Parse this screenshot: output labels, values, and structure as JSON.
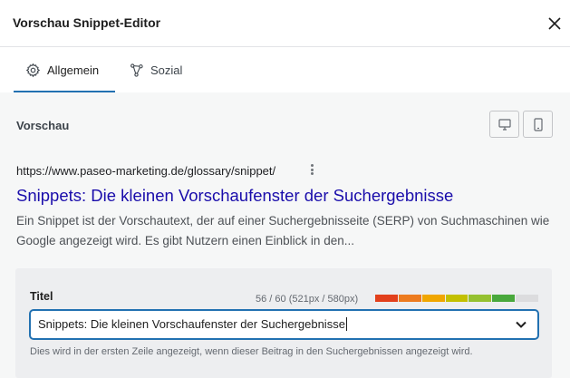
{
  "window": {
    "title": "Vorschau Snippet-Editor"
  },
  "tabs": [
    {
      "label": "Allgemein",
      "icon": "gear-icon",
      "active": true
    },
    {
      "label": "Sozial",
      "icon": "share-icon",
      "active": false
    }
  ],
  "preview": {
    "heading": "Vorschau",
    "device_buttons": [
      {
        "icon": "desktop-icon"
      },
      {
        "icon": "mobile-icon"
      }
    ],
    "serp": {
      "url": "https://www.paseo-marketing.de/glossary/snippet/",
      "title": "Snippets: Die kleinen Vorschaufenster der Suchergebnisse",
      "description": "Ein Snippet ist der Vorschautext, der auf einer Suchergebnisseite (SERP) von Suchmaschinen wie Google angezeigt wird. Es gibt Nutzern einen Einblick in den..."
    }
  },
  "title_field": {
    "label": "Titel",
    "counter": "56 / 60 (521px / 580px)",
    "value": "Snippets: Die kleinen Vorschaufenster der Suchergebnisse",
    "help": "Dies wird in der ersten Zeile angezeigt, wenn dieser Beitrag in den Suchergebnissen angezeigt wird.",
    "length_fraction": 0.9,
    "bar_colors": [
      "#e2401c",
      "#ed7b1f",
      "#f0a600",
      "#c3c000",
      "#95c130",
      "#49a83c",
      "#dcdcde"
    ]
  },
  "colors": {
    "accent": "#2271b1",
    "serp_link": "#1a0dab"
  }
}
